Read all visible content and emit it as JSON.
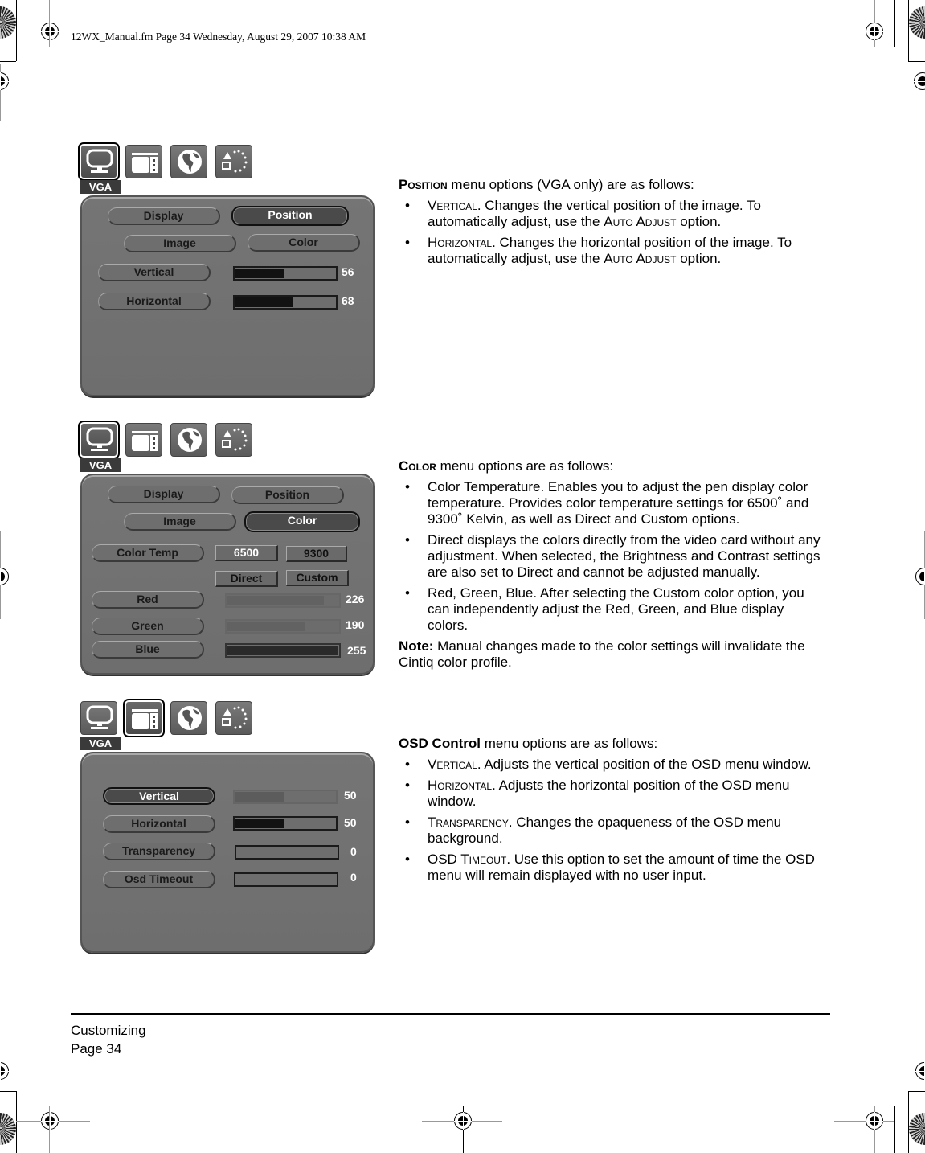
{
  "slug": "12WX_Manual.fm  Page 34  Wednesday, August 29, 2007  10:38 AM",
  "osd_screens": [
    {
      "selected_tab": "display-settings",
      "tabs": [
        "display-settings-icon",
        "osd-control-icon",
        "language-icon",
        "auto-adjust-icon"
      ],
      "source_label": "VGA",
      "menu_buttons": {
        "display": "Display",
        "position": "Position",
        "image": "Image",
        "color": "Color"
      },
      "selected_menu": "Position",
      "rows": [
        {
          "label": "Vertical",
          "value": "56",
          "fraction": 0.49
        },
        {
          "label": "Horizontal",
          "value": "68",
          "fraction": 0.58
        }
      ]
    },
    {
      "selected_tab": "display-settings",
      "source_label": "VGA",
      "menu_buttons": {
        "display": "Display",
        "position": "Position",
        "image": "Image",
        "color": "Color"
      },
      "selected_menu": "Color",
      "color_temp_label": "Color Temp",
      "temp_options": [
        "6500",
        "9300",
        "Direct",
        "Custom"
      ],
      "selected_temp": "6500",
      "rows": [
        {
          "label": "Red",
          "value": "226",
          "fraction": 0.87
        },
        {
          "label": "Green",
          "value": "190",
          "fraction": 0.7
        },
        {
          "label": "Blue",
          "value": "255",
          "fraction": 1.0
        }
      ]
    },
    {
      "selected_tab": "osd-control",
      "source_label": "VGA",
      "selected_menu": "Vertical",
      "rows": [
        {
          "label": "Vertical",
          "value": "50",
          "fraction": 0.5
        },
        {
          "label": "Horizontal",
          "value": "50",
          "fraction": 0.5
        },
        {
          "label": "Transparency",
          "value": "0",
          "fraction": 0
        },
        {
          "label": "Osd Timeout",
          "value": "0",
          "fraction": 0
        }
      ]
    }
  ],
  "sections": {
    "position": {
      "heading_sc": "Position",
      "heading_rest": " menu options (VGA only) are as follows:",
      "bullets": [
        {
          "sc": "Vertical",
          "text": ".  Changes the vertical position of the image. To automatically adjust, use the ",
          "sc2": "Auto Adjust",
          "text2": " option."
        },
        {
          "sc": "Horizontal",
          "text": ". Changes the horizontal position of the image. To automatically adjust, use the ",
          "sc2": "Auto Adjust",
          "text2": " option."
        }
      ]
    },
    "color": {
      "heading_sc": "Color",
      "heading_rest": " menu options are as follows:",
      "bullet1": "Color Temperature.  Enables you to adjust the pen display color temperature.  Provides color temperature settings for 6500˚  and 9300˚ Kelvin, as well as Direct and Custom options.",
      "bullet2": "Direct displays the colors directly from the video card without any adjustment.  When selected, the Brightness and Contrast settings are also set to Direct and cannot be adjusted manually.",
      "bullet3": "Red, Green, Blue.  After selecting the Custom color option, you can independently adjust the Red, Green, and Blue display colors.",
      "note_label": "Note:",
      "note_text": " Manual changes made to the color settings will invalidate the Cintiq color profile."
    },
    "osd": {
      "heading_bold": "OSD Control",
      "heading_rest": " menu options are as follows:",
      "bullets": [
        {
          "sc": "Vertical",
          "text": ".  Adjusts the vertical position of the OSD menu window."
        },
        {
          "sc": "Horizontal",
          "text": ".  Adjusts the horizontal position of the OSD menu window."
        },
        {
          "sc": "Transparency",
          "text": ".  Changes the opaqueness of the OSD menu background."
        },
        {
          "sc": "OSD Timeout",
          "text": ".  Use this option to set the amount of time the OSD menu will remain displayed with no user input."
        }
      ]
    }
  },
  "bullet_glyph": "•",
  "footer": {
    "section": "Customizing",
    "page": "Page  34"
  }
}
